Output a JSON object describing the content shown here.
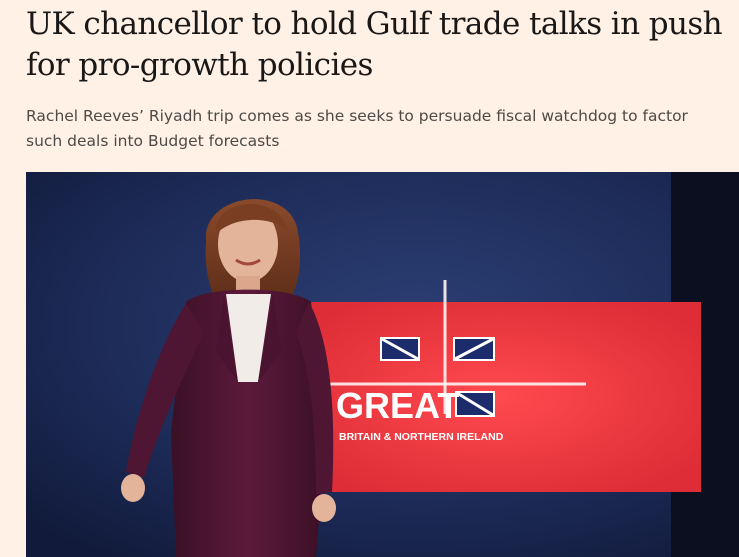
{
  "article": {
    "headline": "UK chancellor to hold Gulf trade talks in push for pro-growth policies",
    "standfirst": "Rachel Reeves’ Riyadh trip comes as she seeks to persuade fiscal watchdog to factor such deals into Budget forecasts"
  },
  "image": {
    "description_icon": "photo-of-speaker-on-stage",
    "sign": {
      "word": "GREAT",
      "subtitle": "BRITAIN & NORTHERN IRELAND"
    }
  },
  "colors": {
    "page_background": "#fff1e5",
    "headline": "#1a1817",
    "standfirst": "#4d4a47",
    "sign_red": "#e8323a",
    "stage_blue": "#1c2a55"
  }
}
